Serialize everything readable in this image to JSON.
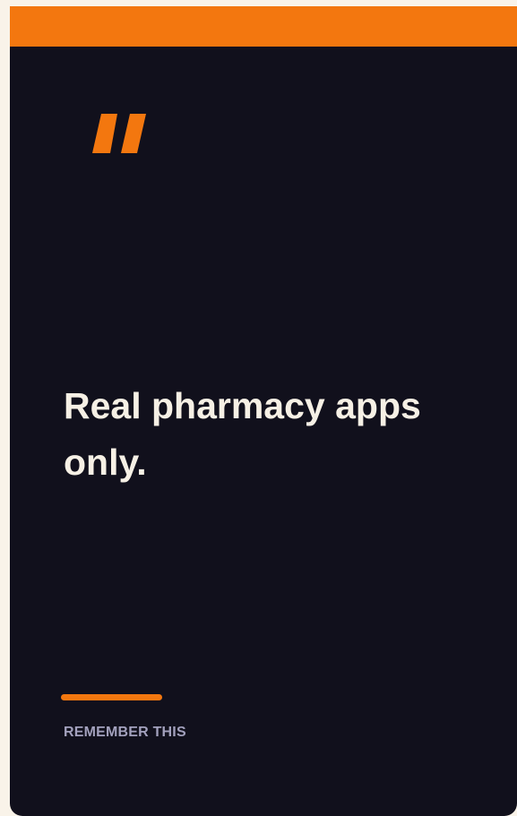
{
  "card": {
    "headline": "Real pharmacy apps only.",
    "footer_label": "REMEMBER THIS"
  },
  "icons": {
    "quote": "quote-mark-icon"
  },
  "colors": {
    "accent": "#f3770f",
    "card_background": "#11101c",
    "page_background": "#f9f3e9",
    "headline_text": "#f6f0e5",
    "label_text": "#a3a1bd"
  }
}
